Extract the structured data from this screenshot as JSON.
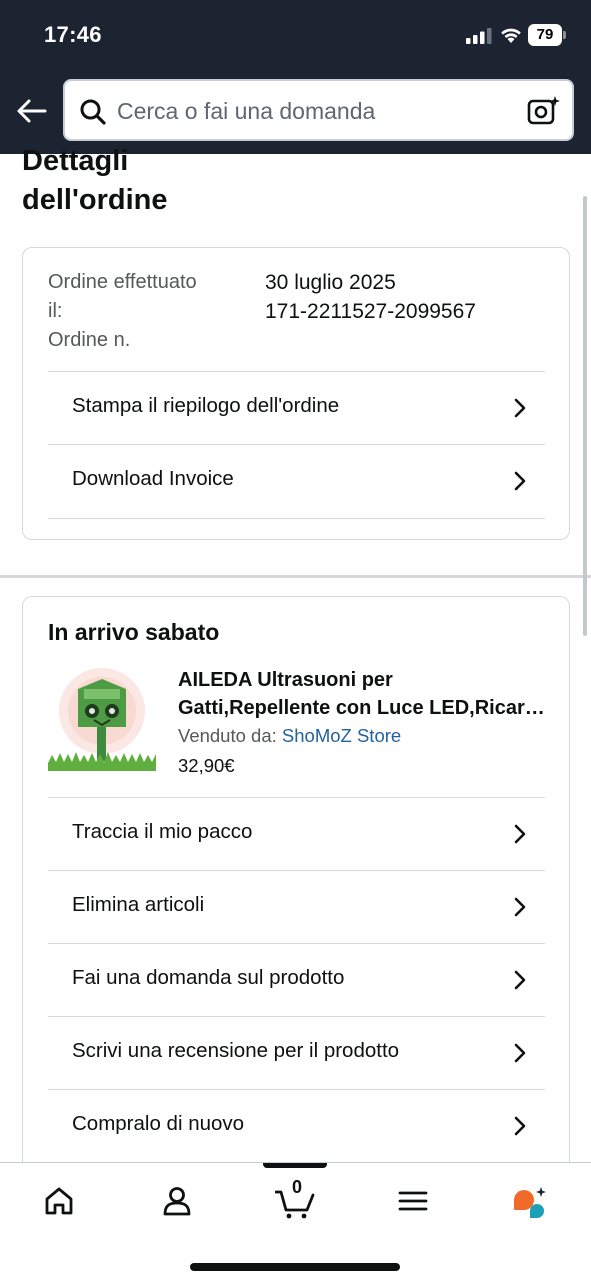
{
  "status_bar": {
    "time": "17:46",
    "battery": "79"
  },
  "header": {
    "search_placeholder": "Cerca o fai una domanda"
  },
  "page": {
    "title": "Dettagli\ndell'ordine"
  },
  "order_info": {
    "labels": "Ordine effettuato\nil:\nOrdine n.",
    "values": "30 luglio 2025\n171-2211527-2099567",
    "actions": [
      {
        "label": "Stampa il riepilogo dell'ordine"
      },
      {
        "label": "Download Invoice"
      }
    ]
  },
  "shipment": {
    "heading": "In arrivo sabato",
    "product": {
      "name_line1": "AILEDA Ultrasuoni per",
      "name_line2": "Gatti,Repellente con Luce LED,Ricaricabile",
      "seller_prefix": "Venduto da: ",
      "seller_name": "ShoMoZ Store",
      "price": "32,90€"
    },
    "actions": [
      {
        "label": "Traccia il mio pacco"
      },
      {
        "label": "Elimina articoli"
      },
      {
        "label": "Fai una domanda sul prodotto"
      },
      {
        "label": "Scrivi una recensione per il prodotto"
      },
      {
        "label": "Compralo di nuovo"
      }
    ]
  },
  "bottom_nav": {
    "cart_count": "0"
  },
  "colors": {
    "header_bg": "#1b2430",
    "link": "#2162a1",
    "rufus_orange": "#f26a2a",
    "rufus_teal": "#1ba0b8"
  }
}
